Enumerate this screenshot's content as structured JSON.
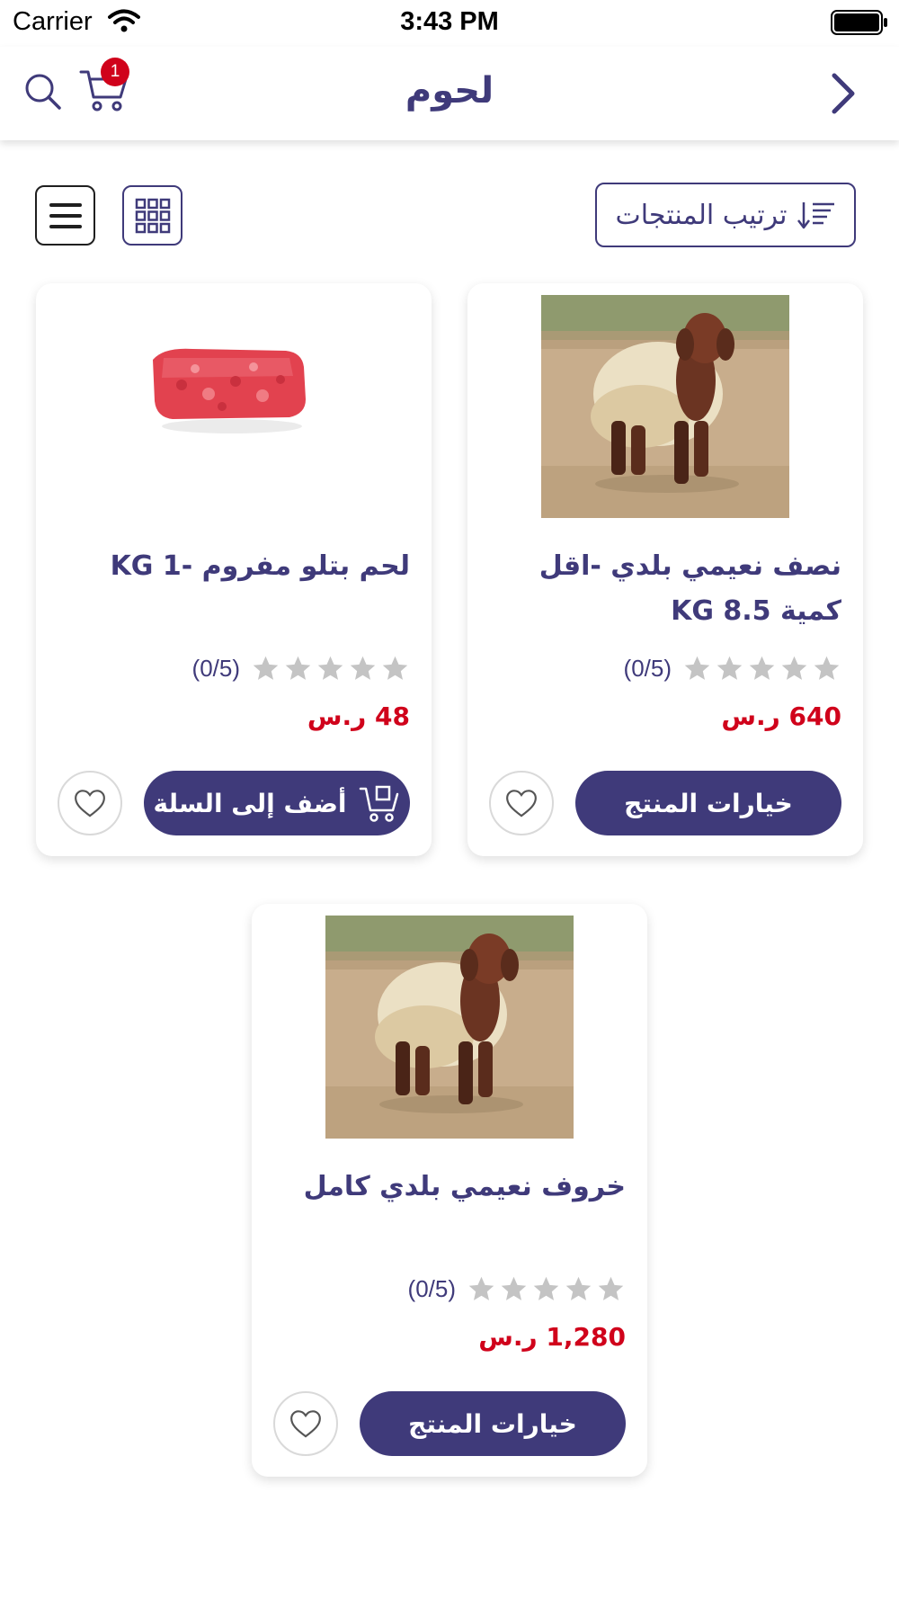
{
  "status_bar": {
    "carrier": "Carrier",
    "time": "3:43 PM"
  },
  "nav": {
    "title": "لحوم",
    "cart_count": "1"
  },
  "toolbar": {
    "sort_label": "ترتيب المنتجات"
  },
  "products": [
    {
      "name": "نصف نعيمي بلدي -اقل كمية KG 8.5",
      "rating": 0,
      "rating_text": "(0/5)",
      "price": "640 ر.س",
      "button": "خيارات المنتج",
      "image": "sheep-photo"
    },
    {
      "name": "لحم بتلو مفروم -1 KG",
      "rating": 0,
      "rating_text": "(0/5)",
      "price": "48 ر.س",
      "button": "أضف إلى السلة",
      "image": "minced-meat-photo"
    },
    {
      "name": "خروف نعيمي بلدي كامل",
      "rating": 0,
      "rating_text": "(0/5)",
      "price": "1,280 ر.س",
      "button": "خيارات المنتج",
      "image": "sheep-photo"
    }
  ],
  "colors": {
    "primary": "#3f3a7a",
    "price": "#d0021b",
    "badge": "#d0021b",
    "star_empty": "#c4c4c4"
  }
}
